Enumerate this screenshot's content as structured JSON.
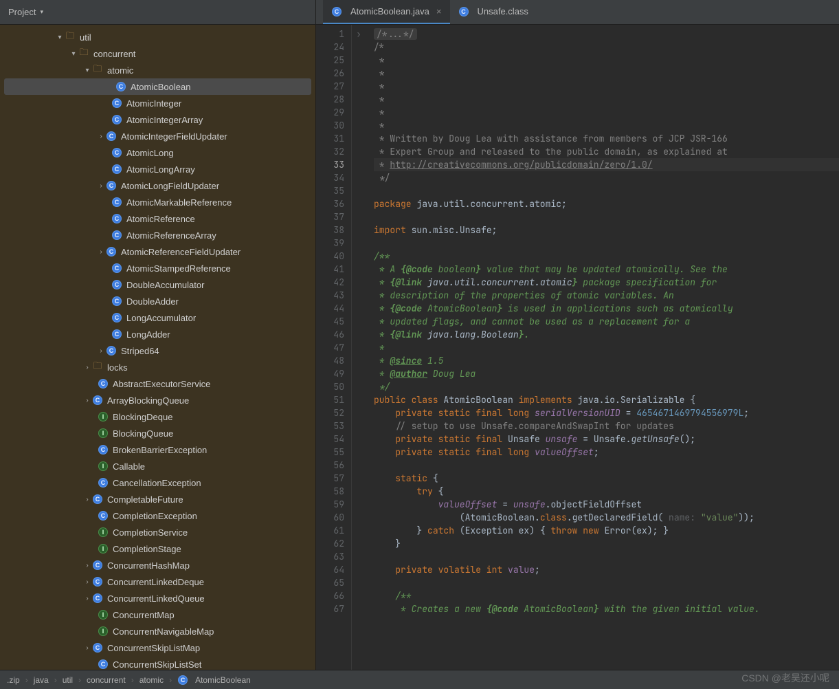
{
  "project_label": "Project",
  "tabs": [
    {
      "label": "AtomicBoolean.java",
      "icon": "class",
      "active": true,
      "closable": true
    },
    {
      "label": "Unsafe.class",
      "icon": "class",
      "active": false,
      "closable": false
    }
  ],
  "tree": [
    {
      "indent": 80,
      "chev": "v",
      "icon": "folder",
      "label": "util"
    },
    {
      "indent": 100,
      "chev": "v",
      "icon": "folder",
      "label": "concurrent"
    },
    {
      "indent": 120,
      "chev": "v",
      "icon": "folder",
      "label": "atomic"
    },
    {
      "indent": 148,
      "chev": "",
      "icon": "class",
      "label": "AtomicBoolean",
      "selected": true
    },
    {
      "indent": 148,
      "chev": "",
      "icon": "class",
      "label": "AtomicInteger"
    },
    {
      "indent": 148,
      "chev": "",
      "icon": "class",
      "label": "AtomicIntegerArray"
    },
    {
      "indent": 140,
      "chev": ">",
      "icon": "class",
      "label": "AtomicIntegerFieldUpdater"
    },
    {
      "indent": 148,
      "chev": "",
      "icon": "class",
      "label": "AtomicLong"
    },
    {
      "indent": 148,
      "chev": "",
      "icon": "class",
      "label": "AtomicLongArray"
    },
    {
      "indent": 140,
      "chev": ">",
      "icon": "class",
      "label": "AtomicLongFieldUpdater"
    },
    {
      "indent": 148,
      "chev": "",
      "icon": "class",
      "label": "AtomicMarkableReference"
    },
    {
      "indent": 148,
      "chev": "",
      "icon": "class",
      "label": "AtomicReference"
    },
    {
      "indent": 148,
      "chev": "",
      "icon": "class",
      "label": "AtomicReferenceArray"
    },
    {
      "indent": 140,
      "chev": ">",
      "icon": "class",
      "label": "AtomicReferenceFieldUpdater"
    },
    {
      "indent": 148,
      "chev": "",
      "icon": "class",
      "label": "AtomicStampedReference"
    },
    {
      "indent": 148,
      "chev": "",
      "icon": "class",
      "label": "DoubleAccumulator"
    },
    {
      "indent": 148,
      "chev": "",
      "icon": "class",
      "label": "DoubleAdder"
    },
    {
      "indent": 148,
      "chev": "",
      "icon": "class",
      "label": "LongAccumulator"
    },
    {
      "indent": 148,
      "chev": "",
      "icon": "class",
      "label": "LongAdder"
    },
    {
      "indent": 140,
      "chev": ">",
      "icon": "class",
      "label": "Striped64"
    },
    {
      "indent": 120,
      "chev": ">",
      "icon": "folder",
      "label": "locks"
    },
    {
      "indent": 128,
      "chev": "",
      "icon": "class",
      "label": "AbstractExecutorService"
    },
    {
      "indent": 120,
      "chev": ">",
      "icon": "class",
      "label": "ArrayBlockingQueue"
    },
    {
      "indent": 128,
      "chev": "",
      "icon": "interface",
      "label": "BlockingDeque"
    },
    {
      "indent": 128,
      "chev": "",
      "icon": "interface",
      "label": "BlockingQueue"
    },
    {
      "indent": 128,
      "chev": "",
      "icon": "class",
      "label": "BrokenBarrierException"
    },
    {
      "indent": 128,
      "chev": "",
      "icon": "interface",
      "label": "Callable"
    },
    {
      "indent": 128,
      "chev": "",
      "icon": "class",
      "label": "CancellationException"
    },
    {
      "indent": 120,
      "chev": ">",
      "icon": "class",
      "label": "CompletableFuture"
    },
    {
      "indent": 128,
      "chev": "",
      "icon": "class",
      "label": "CompletionException"
    },
    {
      "indent": 128,
      "chev": "",
      "icon": "interface",
      "label": "CompletionService"
    },
    {
      "indent": 128,
      "chev": "",
      "icon": "interface",
      "label": "CompletionStage"
    },
    {
      "indent": 120,
      "chev": ">",
      "icon": "class",
      "label": "ConcurrentHashMap"
    },
    {
      "indent": 120,
      "chev": ">",
      "icon": "class",
      "label": "ConcurrentLinkedDeque"
    },
    {
      "indent": 120,
      "chev": ">",
      "icon": "class",
      "label": "ConcurrentLinkedQueue"
    },
    {
      "indent": 128,
      "chev": "",
      "icon": "interface",
      "label": "ConcurrentMap"
    },
    {
      "indent": 128,
      "chev": "",
      "icon": "interface",
      "label": "ConcurrentNavigableMap"
    },
    {
      "indent": 120,
      "chev": ">",
      "icon": "class",
      "label": "ConcurrentSkipListMap"
    },
    {
      "indent": 128,
      "chev": "",
      "icon": "class",
      "label": "ConcurrentSkipListSet"
    }
  ],
  "gutter_lines": [
    "1",
    "24",
    "25",
    "26",
    "27",
    "28",
    "29",
    "30",
    "31",
    "32",
    "33",
    "34",
    "35",
    "36",
    "37",
    "38",
    "39",
    "40",
    "41",
    "42",
    "43",
    "44",
    "45",
    "46",
    "47",
    "48",
    "49",
    "50",
    "51",
    "52",
    "53",
    "54",
    "55",
    "56",
    "57",
    "58",
    "59",
    "60",
    "61",
    "62",
    "63",
    "64",
    "65",
    "66",
    "67"
  ],
  "current_line": "33",
  "code_lines": [
    {
      "html": "<span class='c-fold'>/*...*/</span>"
    },
    {
      "html": "<span class='c-comment'>/*</span>"
    },
    {
      "html": "<span class='c-comment'> *</span>"
    },
    {
      "html": "<span class='c-comment'> *</span>"
    },
    {
      "html": "<span class='c-comment'> *</span>"
    },
    {
      "html": "<span class='c-comment'> *</span>"
    },
    {
      "html": "<span class='c-comment'> *</span>"
    },
    {
      "html": "<span class='c-comment'> *</span>"
    },
    {
      "html": "<span class='c-comment'> * Written by Doug Lea with assistance from members of JCP JSR-166</span>"
    },
    {
      "html": "<span class='c-comment'> * Expert Group and released to the public domain, as explained at</span>"
    },
    {
      "hl": true,
      "html": "<span class='c-comment'> * </span><span class='c-link'>http://creativecommons.org/publicdomain/zero/1.0/</span>"
    },
    {
      "html": "<span class='c-comment'> */</span>"
    },
    {
      "html": ""
    },
    {
      "html": "<span class='c-key'>package</span> java.util.concurrent.atomic;"
    },
    {
      "html": ""
    },
    {
      "html": "<span class='c-key'>import</span> sun.misc.Unsafe;"
    },
    {
      "html": ""
    },
    {
      "html": "<span class='c-doc'>/**</span>"
    },
    {
      "html": "<span class='c-doc'> * A </span><span class='c-doctag'>{@code</span><span class='c-doc'> boolean</span><span class='c-doctag'>}</span><span class='c-doc'> value that may be updated atomically. See the</span>"
    },
    {
      "html": "<span class='c-doc'> * </span><span class='c-doctag'>{@link</span><span class='c-doc'> </span><span style='color:#a9b7c6;font-style:italic'>java.util.concurrent.atomic</span><span class='c-doctag'>}</span><span class='c-doc'> package specification for</span>"
    },
    {
      "html": "<span class='c-doc'> * description of the properties of atomic variables. An</span>"
    },
    {
      "html": "<span class='c-doc'> * </span><span class='c-doctag'>{@code</span><span class='c-doc'> AtomicBoolean</span><span class='c-doctag'>}</span><span class='c-doc'> is used in applications such as atomically</span>"
    },
    {
      "html": "<span class='c-doc'> * updated flags, and cannot be used as a replacement for a</span>"
    },
    {
      "html": "<span class='c-doc'> * </span><span class='c-doctag'>{@link</span><span class='c-doc'> </span><span style='color:#a9b7c6;font-style:italic'>java.lang.Boolean</span><span class='c-doctag'>}</span><span class='c-doc'>.</span>"
    },
    {
      "html": "<span class='c-doc'> *</span>"
    },
    {
      "html": "<span class='c-doc'> * </span><span class='c-doctag' style='text-decoration:underline'>@since</span><span class='c-doc'> 1.5</span>"
    },
    {
      "html": "<span class='c-doc'> * </span><span class='c-doctag' style='text-decoration:underline'>@author</span><span class='c-doc'> Doug Lea</span>"
    },
    {
      "html": "<span class='c-doc'> */</span>"
    },
    {
      "html": "<span class='c-key'>public class</span> AtomicBoolean <span class='c-key'>implements</span> java.io.Serializable {"
    },
    {
      "html": "    <span class='c-key'>private static final long</span> <span class='c-purple' style='font-style:italic'>serialVersionUID</span> = <span class='c-num'>4654671469794556979L</span>;"
    },
    {
      "html": "    <span class='c-comment'>// setup to use Unsafe.compareAndSwapInt for updates</span>"
    },
    {
      "html": "    <span class='c-key'>private static final</span> Unsafe <span class='c-purple' style='font-style:italic'>unsafe</span> = Unsafe.<span style='font-style:italic'>getUnsafe</span>();"
    },
    {
      "html": "    <span class='c-key'>private static final long</span> <span class='c-purple' style='font-style:italic'>valueOffset</span>;"
    },
    {
      "html": ""
    },
    {
      "html": "    <span class='c-key'>static</span> {"
    },
    {
      "html": "        <span class='c-key'>try</span> {"
    },
    {
      "html": "            <span class='c-purple' style='font-style:italic'>valueOffset</span> = <span class='c-purple' style='font-style:italic'>unsafe</span>.objectFieldOffset"
    },
    {
      "html": "                (AtomicBoolean.<span class='c-key'>class</span>.getDeclaredField( <span class='c-hint'>name:</span> <span class='c-str'>\"value\"</span>));"
    },
    {
      "html": "        } <span class='c-key'>catch</span> (Exception ex) { <span class='c-key'>throw new</span> Error(ex); }"
    },
    {
      "html": "    }"
    },
    {
      "html": ""
    },
    {
      "html": "    <span class='c-key'>private volatile int</span> <span class='c-purple'>value</span>;"
    },
    {
      "html": ""
    },
    {
      "html": "    <span class='c-doc'>/**</span>"
    },
    {
      "html": "<span class='c-doc'>     * Creates a new </span><span class='c-doctag'>{@code</span><span class='c-doc'> AtomicBoolean</span><span class='c-doctag'>}</span><span class='c-doc'> with the given initial value.</span>"
    },
    {
      "html": "<span class='c-doc'>     *</span>"
    }
  ],
  "breadcrumb": [
    ".zip",
    "java",
    "util",
    "concurrent",
    "atomic",
    "AtomicBoolean"
  ],
  "breadcrumb_icon_index": 5,
  "watermark": "CSDN @老吴还小呢"
}
